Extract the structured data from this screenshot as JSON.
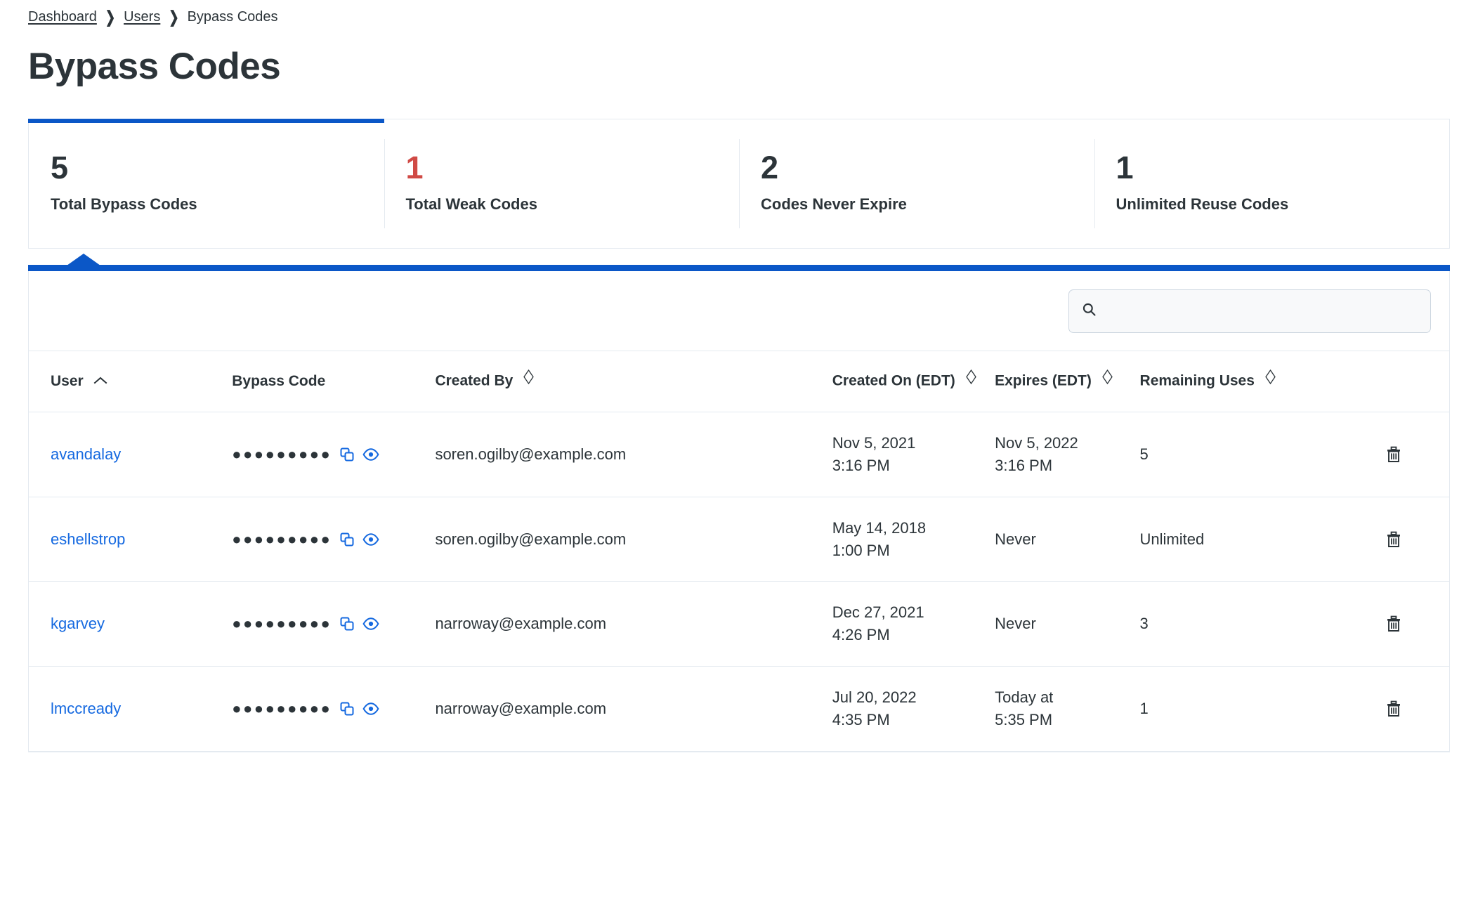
{
  "breadcrumb": {
    "items": [
      {
        "label": "Dashboard",
        "link": true
      },
      {
        "label": "Users",
        "link": true
      },
      {
        "label": "Bypass Codes",
        "link": false
      }
    ],
    "separator": "❯"
  },
  "page": {
    "title": "Bypass Codes"
  },
  "colors": {
    "accent_blue": "#0b57c7",
    "link_blue": "#1569e0",
    "danger_red": "#d04a45",
    "text_dark": "#2c3439",
    "border": "#e4eaf0"
  },
  "stats": [
    {
      "value": "5",
      "label": "Total Bypass Codes",
      "active": true,
      "danger": false
    },
    {
      "value": "1",
      "label": "Total Weak Codes",
      "active": false,
      "danger": true
    },
    {
      "value": "2",
      "label": "Codes Never Expire",
      "active": false,
      "danger": false
    },
    {
      "value": "1",
      "label": "Unlimited Reuse Codes",
      "active": false,
      "danger": false
    }
  ],
  "search": {
    "value": "",
    "placeholder": "",
    "icon": "search-icon"
  },
  "table": {
    "columns": [
      {
        "label": "User",
        "sort": "asc",
        "key": "user"
      },
      {
        "label": "Bypass Code",
        "sort": "none",
        "key": "code"
      },
      {
        "label": "Created By",
        "sort": "unsorted",
        "key": "created_by"
      },
      {
        "label": "Created On (EDT)",
        "sort": "unsorted",
        "key": "created_on"
      },
      {
        "label": "Expires (EDT)",
        "sort": "unsorted",
        "key": "expires"
      },
      {
        "label": "Remaining Uses",
        "sort": "unsorted",
        "key": "remaining"
      },
      {
        "label": "",
        "sort": "none",
        "key": "actions"
      }
    ],
    "rows": [
      {
        "user": "avandalay",
        "code_mask": "●●●●●●●●●",
        "created_by": "soren.ogilby@example.com",
        "created_on_date": "Nov 5, 2021",
        "created_on_time": "3:16 PM",
        "expires_date": "Nov 5, 2022",
        "expires_time": "3:16 PM",
        "remaining": "5"
      },
      {
        "user": "eshellstrop",
        "code_mask": "●●●●●●●●●",
        "created_by": "soren.ogilby@example.com",
        "created_on_date": "May 14, 2018",
        "created_on_time": "1:00 PM",
        "expires_date": "Never",
        "expires_time": "",
        "remaining": "Unlimited"
      },
      {
        "user": "kgarvey",
        "code_mask": "●●●●●●●●●",
        "created_by": "narroway@example.com",
        "created_on_date": "Dec 27, 2021",
        "created_on_time": "4:26 PM",
        "expires_date": "Never",
        "expires_time": "",
        "remaining": "3"
      },
      {
        "user": "lmccready",
        "code_mask": "●●●●●●●●●",
        "created_by": "narroway@example.com",
        "created_on_date": "Jul 20, 2022",
        "created_on_time": "4:35 PM",
        "expires_date": "Today at",
        "expires_time": "5:35 PM",
        "remaining": "1"
      }
    ],
    "row_icons": {
      "copy": "copy-icon",
      "reveal": "eye-icon",
      "delete": "trash-icon"
    }
  }
}
